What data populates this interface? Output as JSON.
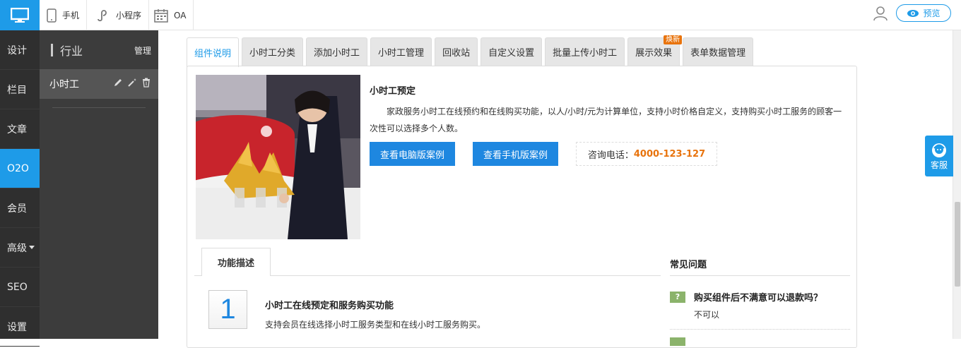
{
  "topbar": {
    "items": [
      {
        "label": "手机",
        "icon": "phone-icon"
      },
      {
        "label": "小程序",
        "icon": "miniprogram-icon"
      },
      {
        "label": "OA",
        "icon": "calendar-icon"
      }
    ],
    "preview_label": "预览"
  },
  "leftnav": {
    "items": [
      {
        "label": "设计"
      },
      {
        "label": "栏目"
      },
      {
        "label": "文章"
      },
      {
        "label": "O2O",
        "active": true
      },
      {
        "label": "会员"
      },
      {
        "label": "高级"
      },
      {
        "label": "SEO"
      },
      {
        "label": "设置"
      }
    ]
  },
  "subnav": {
    "title": "行业",
    "manage": "管理",
    "row_label": "小时工"
  },
  "tabs": [
    {
      "label": "组件说明",
      "active": true
    },
    {
      "label": "小时工分类"
    },
    {
      "label": "添加小时工"
    },
    {
      "label": "小时工管理"
    },
    {
      "label": "回收站"
    },
    {
      "label": "自定义设置"
    },
    {
      "label": "批量上传小时工"
    },
    {
      "label": "展示效果",
      "badge": "焕新"
    },
    {
      "label": "表单数据管理"
    }
  ],
  "intro": {
    "title": "小时工预定",
    "description": "家政服务小时工在线预约和在线购买功能，以人/小时/元为计算单位，支持小时价格自定义，支持购买小时工服务的顾客一次性可以选择多个人数。",
    "btn_pc": "查看电脑版案例",
    "btn_mobile": "查看手机版案例",
    "phone_label": "咨询电话：",
    "phone_number": "4000-123-127"
  },
  "feature": {
    "tab_label": "功能描述",
    "number": "1",
    "title": "小时工在线预定和服务购买功能",
    "desc": "支持会员在线选择小时工服务类型和在线小时工服务购买。"
  },
  "faq": {
    "title": "常见问题",
    "q1": "购买组件后不满意可以退款吗？",
    "q1_mark": "?",
    "a1": "不可以"
  },
  "kefu": {
    "label": "客服"
  },
  "colors": {
    "accent": "#1e9be8",
    "orange": "#e8730c",
    "faq_green": "#8bb36b"
  }
}
